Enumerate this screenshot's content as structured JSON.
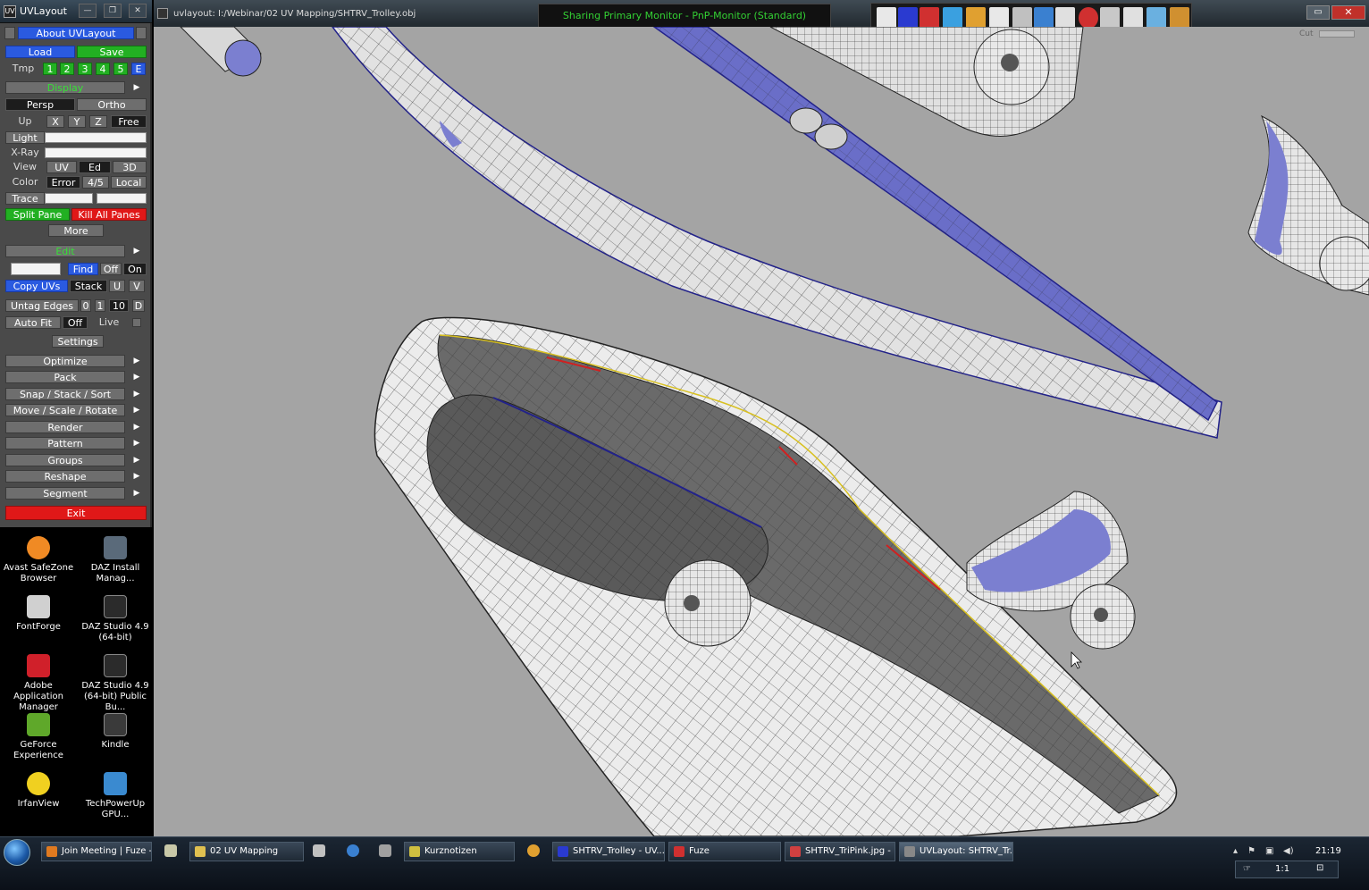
{
  "left_window": {
    "title": "UVLayout",
    "about": "About UVLayout",
    "load": "Load",
    "save": "Save",
    "tmp_label": "Tmp",
    "tmp_slots": [
      "1",
      "2",
      "3",
      "4",
      "5",
      "E"
    ],
    "display": "Display",
    "persp": "Persp",
    "ortho": "Ortho",
    "up_label": "Up",
    "up_x": "X",
    "up_y": "Y",
    "up_z": "Z",
    "up_free": "Free",
    "light": "Light",
    "xray": "X-Ray",
    "view_label": "View",
    "view_uv": "UV",
    "view_ed": "Ed",
    "view_3d": "3D",
    "color_label": "Color",
    "color_error": "Error",
    "color_45": "4/5",
    "color_local": "Local",
    "trace": "Trace",
    "split_pane": "Split Pane",
    "kill_all_panes": "Kill All Panes",
    "more": "More",
    "edit": "Edit",
    "find": "Find",
    "find_off": "Off",
    "find_on": "On",
    "copy_uvs": "Copy UVs",
    "stack": "Stack",
    "u": "U",
    "v": "V",
    "untag_edges": "Untag Edges",
    "untag_0": "0",
    "untag_1": "1",
    "untag_10": "10",
    "untag_d": "D",
    "auto_fit": "Auto Fit",
    "auto_fit_off": "Off",
    "live": "Live",
    "settings": "Settings",
    "menus": [
      "Optimize",
      "Pack",
      "Snap / Stack / Sort",
      "Move / Scale / Rotate",
      "Render",
      "Pattern",
      "Groups",
      "Reshape",
      "Segment"
    ],
    "exit": "Exit"
  },
  "desktop_icons": [
    {
      "label": "Avast SafeZone Browser",
      "color": "#f08a24"
    },
    {
      "label": "DAZ Install Manag...",
      "color": "#5a6a7a"
    },
    {
      "label": "FontForge",
      "color": "#d0d0d0"
    },
    {
      "label": "DAZ Studio 4.9 (64-bit)",
      "color": "#2b2b2b"
    },
    {
      "label": "Adobe Application Manager",
      "color": "#d0202a"
    },
    {
      "label": "DAZ Studio 4.9 (64-bit) Public Bu...",
      "color": "#2b2b2b"
    },
    {
      "label": "GeForce Experience",
      "color": "#5fa82a"
    },
    {
      "label": "Kindle",
      "color": "#3a3a3a"
    },
    {
      "label": "IrfanView",
      "color": "#f0d020"
    },
    {
      "label": "TechPowerUp GPU...",
      "color": "#3a8ad0"
    }
  ],
  "main_window": {
    "title": "uvlayout: I:/Webinar/02 UV Mapping/SHTRV_Trolley.obj",
    "share_banner": "Sharing Primary Monitor - PnP-Monitor (Standard)",
    "cut_label": "Cut",
    "toolbar_icon_colors": [
      "#e8e8e8",
      "#2a3ad0",
      "#d03030",
      "#3aa0e0",
      "#e0a030",
      "#e8e8e8",
      "#c0c0c0",
      "#3a80d0",
      "#e0e0e0",
      "#d03030",
      "#c8c8c8",
      "#e0e0e0",
      "#6ab0e0",
      "#d09030"
    ]
  },
  "taskbar": {
    "tasks": [
      {
        "label": "Join Meeting | Fuze -...",
        "color": "#e07a20"
      },
      {
        "label": "02 UV Mapping",
        "color": "#e0c050"
      },
      {
        "label": "Kurznotizen",
        "color": "#d0c040"
      },
      {
        "label": "SHTRV_Trolley - UV...",
        "color": "#2a3ad0"
      },
      {
        "label": "Fuze",
        "color": "#d03030"
      },
      {
        "label": "SHTRV_TriPink.jpg - ...",
        "color": "#d04040"
      },
      {
        "label": "UVLayout: SHTRV_Tr...",
        "color": "#888888"
      }
    ],
    "clock": "21:19",
    "tray_ratio": "1:1"
  }
}
